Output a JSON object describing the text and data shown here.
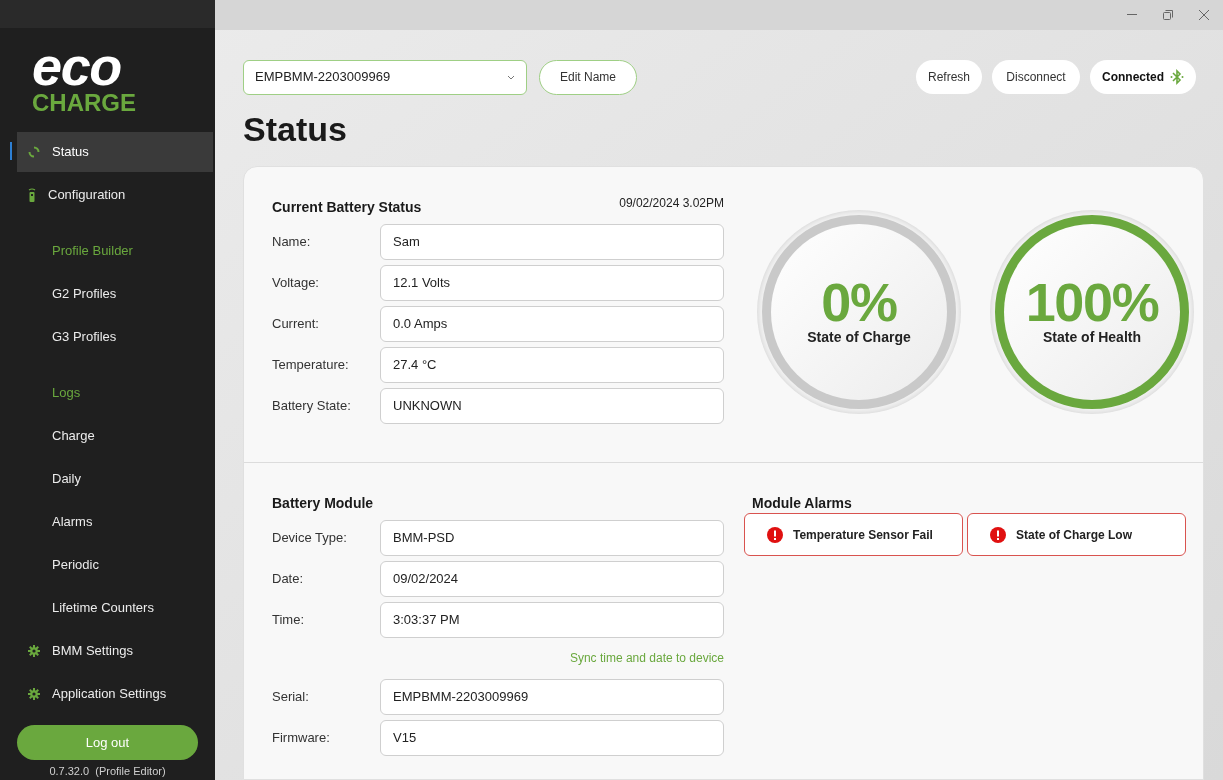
{
  "logo": {
    "top": "eco",
    "bottom": "CHARGE"
  },
  "sidebar": {
    "items": [
      {
        "label": "Status",
        "kind": "status",
        "selected": true
      },
      {
        "label": "Configuration",
        "kind": "remote",
        "selected": false
      },
      {
        "label": "Profile Builder",
        "kind": "heading"
      },
      {
        "label": "G2 Profiles",
        "kind": "link",
        "selected": false
      },
      {
        "label": "G3 Profiles",
        "kind": "link",
        "selected": false
      },
      {
        "label": "Logs",
        "kind": "heading"
      },
      {
        "label": "Charge",
        "kind": "link",
        "selected": false
      },
      {
        "label": "Daily",
        "kind": "link",
        "selected": false
      },
      {
        "label": "Alarms",
        "kind": "link",
        "selected": false
      },
      {
        "label": "Periodic",
        "kind": "link",
        "selected": false
      },
      {
        "label": "Lifetime Counters",
        "kind": "link",
        "selected": false
      },
      {
        "label": "BMM Settings",
        "kind": "settings",
        "selected": false
      },
      {
        "label": "Application Settings",
        "kind": "settings",
        "selected": false
      }
    ],
    "logout": "Log out",
    "version": "0.7.32.0  (Profile Editor)"
  },
  "toolbar": {
    "device": "EMPBMM-2203009969",
    "edit_name": "Edit Name",
    "refresh": "Refresh",
    "disconnect": "Disconnect",
    "connection": "Connected"
  },
  "page_title": "Status",
  "battery_status": {
    "title": "Current Battery Status",
    "timestamp": "09/02/2024 3.02PM",
    "fields": [
      {
        "label": "Name:",
        "value": "Sam"
      },
      {
        "label": "Voltage:",
        "value": "12.1 Volts"
      },
      {
        "label": "Current:",
        "value": "0.0 Amps"
      },
      {
        "label": "Temperature:",
        "value": "27.4 °C"
      },
      {
        "label": "Battery State:",
        "value": "UNKNOWN"
      }
    ]
  },
  "gauges": [
    {
      "value": "0%",
      "label": "State of Charge",
      "color": "#c9c9c9"
    },
    {
      "value": "100%",
      "label": "State of Health",
      "color": "#6aa83e"
    }
  ],
  "battery_module": {
    "title": "Battery Module",
    "fields": [
      {
        "label": "Device Type:",
        "value": "BMM-PSD"
      },
      {
        "label": "Date:",
        "value": "09/02/2024"
      },
      {
        "label": "Time:",
        "value": "3:03:37 PM"
      }
    ],
    "sync_link": "Sync time and date to device",
    "more_fields": [
      {
        "label": "Serial:",
        "value": "EMPBMM-2203009969"
      },
      {
        "label": "Firmware:",
        "value": "V15"
      }
    ]
  },
  "module_alarms": {
    "title": "Module Alarms",
    "alarms": [
      "Temperature Sensor Fail",
      "State of Charge Low"
    ]
  }
}
